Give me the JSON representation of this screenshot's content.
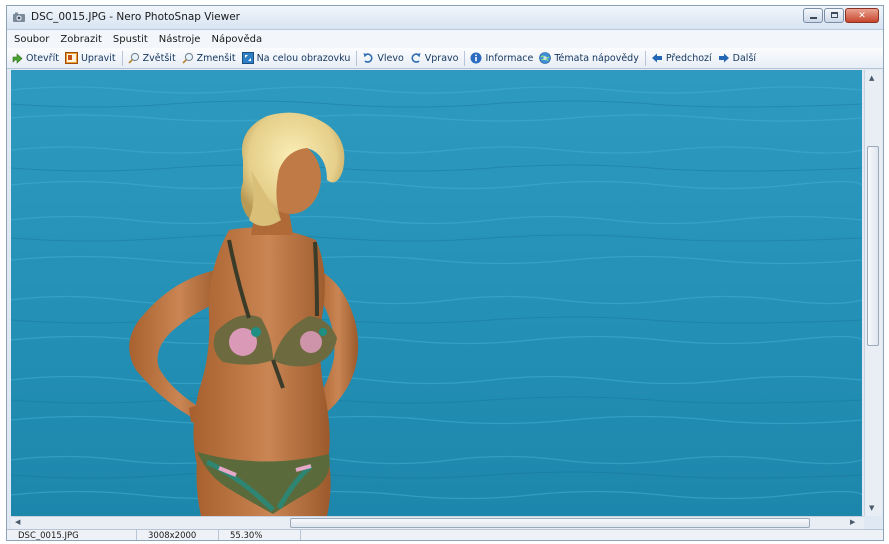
{
  "window": {
    "title": "DSC_0015.JPG - Nero PhotoSnap Viewer"
  },
  "menu": [
    {
      "label": "Soubor"
    },
    {
      "label": "Zobrazit"
    },
    {
      "label": "Spustit"
    },
    {
      "label": "Nástroje"
    },
    {
      "label": "Nápověda"
    }
  ],
  "toolbar": {
    "open": "Otevřít",
    "edit": "Upravit",
    "zoom_in": "Zvětšit",
    "zoom_out": "Zmenšit",
    "fullscreen": "Na celou obrazovku",
    "rotate_left": "Vlevo",
    "rotate_right": "Vpravo",
    "info": "Informace",
    "help_topics": "Témata nápovědy",
    "previous": "Předchozí",
    "next": "Další"
  },
  "photo": {
    "description_icon": "image-content"
  },
  "status": {
    "filename": "DSC_0015.JPG",
    "dimensions": "3008x2000",
    "zoom": "55.30%"
  },
  "colors": {
    "water": "#2a97b8",
    "water_dark": "#1c7fa2",
    "accent": "#14365e",
    "close_button": "#c8452d"
  }
}
